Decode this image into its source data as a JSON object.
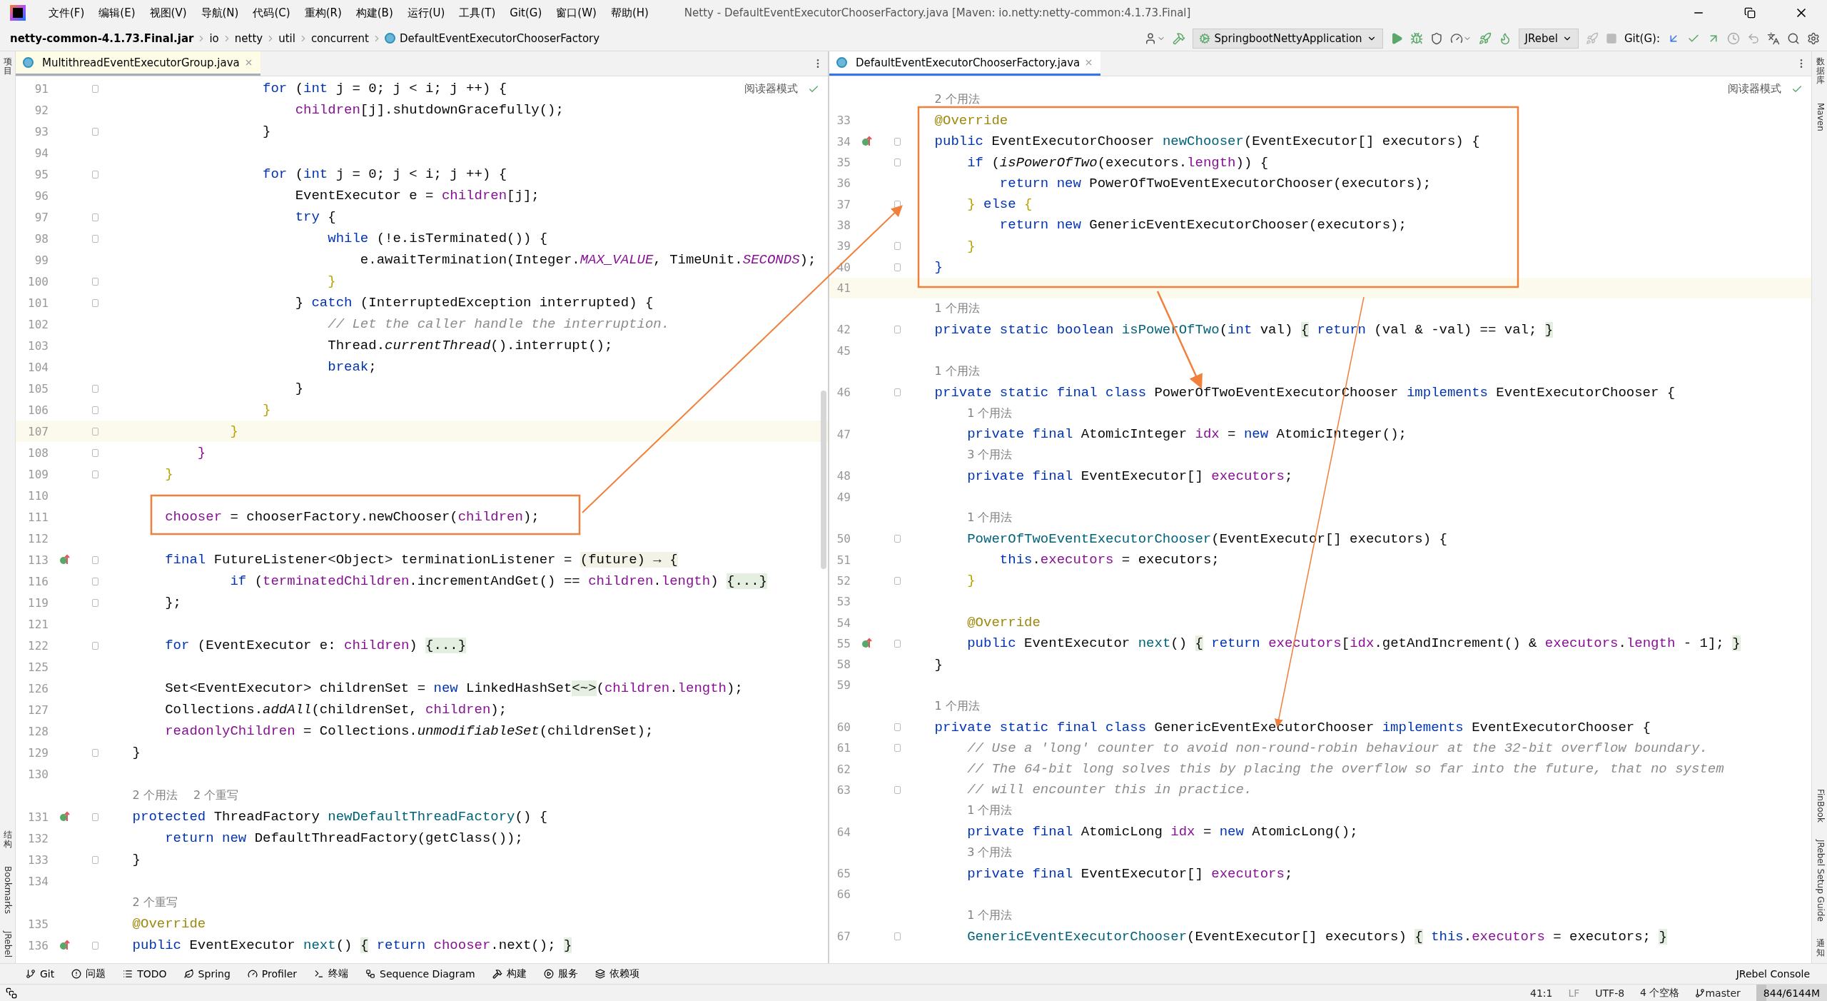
{
  "window": {
    "title": "Netty - DefaultEventExecutorChooserFactory.java [Maven: io.netty:netty-common:4.1.73.Final]"
  },
  "menu": [
    "文件(F)",
    "编辑(E)",
    "视图(V)",
    "导航(N)",
    "代码(C)",
    "重构(R)",
    "构建(B)",
    "运行(U)",
    "工具(T)",
    "Git(G)",
    "窗口(W)",
    "帮助(H)"
  ],
  "breadcrumb": [
    {
      "label": "netty-common-4.1.73.Final.jar",
      "kind": "jar"
    },
    {
      "label": "io",
      "kind": "folder"
    },
    {
      "label": "netty",
      "kind": "folder"
    },
    {
      "label": "util",
      "kind": "folder"
    },
    {
      "label": "concurrent",
      "kind": "folder"
    },
    {
      "label": "DefaultEventExecutorChooserFactory",
      "kind": "class"
    }
  ],
  "toolbar": {
    "run_config": "SpringbootNettyApplication",
    "jrebel": "JRebel",
    "git_label": "Git(G):"
  },
  "left_strip": {
    "top": [
      "项目"
    ],
    "bottom": [
      "结构",
      "Bookmarks",
      "JRebel"
    ]
  },
  "right_strip": {
    "top": [
      "数据库",
      "Maven"
    ],
    "bottom": [
      "FinBook",
      "JRebel Setup Guide",
      "通知"
    ]
  },
  "panes": [
    {
      "tab": {
        "label": "MultithreadEventExecutorGroup.java",
        "selected": false
      },
      "reader_mode": "阅读器模式",
      "lines": [
        {
          "number": "91",
          "fold": true,
          "segments": [
            {
              "text": "                    for",
              "kind": "keyword"
            },
            {
              "text": " (",
              "kind": "plain"
            },
            {
              "text": "int",
              "kind": "keyword"
            },
            {
              "text": " j = 0; j < i; j ++) {",
              "kind": "plain"
            }
          ]
        },
        {
          "number": "92",
          "segments": [
            {
              "text": "                        children",
              "kind": "field"
            },
            {
              "text": "[j].shutdownGracefully();",
              "kind": "plain"
            }
          ]
        },
        {
          "number": "93",
          "fold": true,
          "segments": [
            {
              "text": "                    }",
              "kind": "plain"
            }
          ]
        },
        {
          "number": "94"
        },
        {
          "number": "95",
          "fold": true,
          "segments": [
            {
              "text": "                    for",
              "kind": "keyword"
            },
            {
              "text": " (",
              "kind": "plain"
            },
            {
              "text": "int",
              "kind": "keyword"
            },
            {
              "text": " j = 0; j < i; j ++) {",
              "kind": "plain"
            }
          ]
        },
        {
          "number": "96",
          "segments": [
            {
              "text": "                        EventExecutor e = ",
              "kind": "plain"
            },
            {
              "text": "children",
              "kind": "field"
            },
            {
              "text": "[j];",
              "kind": "plain"
            }
          ]
        },
        {
          "number": "97",
          "fold": true,
          "segments": [
            {
              "text": "                        try",
              "kind": "keyword"
            },
            {
              "text": " {",
              "kind": "plain"
            }
          ]
        },
        {
          "number": "98",
          "fold": true,
          "segments": [
            {
              "text": "                            while",
              "kind": "keyword"
            },
            {
              "text": " (!e.isTerminated()) {",
              "kind": "plain"
            }
          ]
        },
        {
          "number": "99",
          "segments": [
            {
              "text": "                                e.awaitTermination(Integer.",
              "kind": "plain"
            },
            {
              "text": "MAX_VALUE",
              "kind": "static-field"
            },
            {
              "text": ", TimeUnit.",
              "kind": "plain"
            },
            {
              "text": "SECONDS",
              "kind": "static-field"
            },
            {
              "text": ");",
              "kind": "plain"
            }
          ]
        },
        {
          "number": "100",
          "fold": true,
          "segments": [
            {
              "text": "                            }",
              "kind": "brace"
            }
          ]
        },
        {
          "number": "101",
          "fold": true,
          "segments": [
            {
              "text": "                        } ",
              "kind": "plain"
            },
            {
              "text": "catch",
              "kind": "keyword"
            },
            {
              "text": " (InterruptedException interrupted) {",
              "kind": "plain"
            }
          ]
        },
        {
          "number": "102",
          "segments": [
            {
              "text": "                            // Let the caller handle the interruption.",
              "kind": "comment"
            }
          ]
        },
        {
          "number": "103",
          "segments": [
            {
              "text": "                            Thread.",
              "kind": "plain"
            },
            {
              "text": "currentThread",
              "kind": "static"
            },
            {
              "text": "().interrupt();",
              "kind": "plain"
            }
          ]
        },
        {
          "number": "104",
          "segments": [
            {
              "text": "                            break",
              "kind": "keyword"
            },
            {
              "text": ";",
              "kind": "plain"
            }
          ]
        },
        {
          "number": "105",
          "fold": true,
          "segments": [
            {
              "text": "                        }",
              "kind": "plain"
            }
          ]
        },
        {
          "number": "106",
          "fold": true,
          "segments": [
            {
              "text": "                    }",
              "kind": "brace"
            }
          ]
        },
        {
          "number": "107",
          "fold": true,
          "current": true,
          "segments": [
            {
              "text": "                }",
              "kind": "brace"
            }
          ]
        },
        {
          "number": "108",
          "fold": true,
          "segments": [
            {
              "text": "            }",
              "kind": "field"
            }
          ]
        },
        {
          "number": "109",
          "fold": true,
          "segments": [
            {
              "text": "        }",
              "kind": "brace"
            }
          ]
        },
        {
          "number": "110"
        },
        {
          "number": "111",
          "segments": [
            {
              "text": "        chooser",
              "kind": "field"
            },
            {
              "text": " = chooserFactory.newChooser(",
              "kind": "plain"
            },
            {
              "text": "children",
              "kind": "field"
            },
            {
              "text": ");",
              "kind": "plain"
            }
          ]
        },
        {
          "number": "112"
        },
        {
          "number": "113",
          "fold": true,
          "gutter_mark": true,
          "segments": [
            {
              "text": "        final",
              "kind": "keyword"
            },
            {
              "text": " FutureListener<Object> terminationListener = ",
              "kind": "plain"
            },
            {
              "text": "(future) → {",
              "kind": "lambda"
            }
          ]
        },
        {
          "number": "116",
          "fold": true,
          "segments": [
            {
              "text": "                if",
              "kind": "keyword"
            },
            {
              "text": " (",
              "kind": "plain"
            },
            {
              "text": "terminatedChildren",
              "kind": "field"
            },
            {
              "text": ".incrementAndGet() == ",
              "kind": "plain"
            },
            {
              "text": "children",
              "kind": "field"
            },
            {
              "text": ".",
              "kind": "plain"
            },
            {
              "text": "length",
              "kind": "field"
            },
            {
              "text": ") ",
              "kind": "plain"
            },
            {
              "text": "{...}",
              "kind": "folded"
            }
          ]
        },
        {
          "number": "119",
          "fold": true,
          "segments": [
            {
              "text": "        };",
              "kind": "plain"
            }
          ]
        },
        {
          "number": "121"
        },
        {
          "number": "122",
          "fold": true,
          "segments": [
            {
              "text": "        for",
              "kind": "keyword"
            },
            {
              "text": " (EventExecutor e: ",
              "kind": "plain"
            },
            {
              "text": "children",
              "kind": "field"
            },
            {
              "text": ") ",
              "kind": "plain"
            },
            {
              "text": "{...}",
              "kind": "folded"
            }
          ]
        },
        {
          "number": "125"
        },
        {
          "number": "126",
          "segments": [
            {
              "text": "        Set<EventExecutor> childrenSet = ",
              "kind": "plain"
            },
            {
              "text": "new",
              "kind": "keyword"
            },
            {
              "text": " LinkedHashSet",
              "kind": "plain"
            },
            {
              "text": "<~>",
              "kind": "folded"
            },
            {
              "text": "(",
              "kind": "plain"
            },
            {
              "text": "children",
              "kind": "field"
            },
            {
              "text": ".",
              "kind": "plain"
            },
            {
              "text": "length",
              "kind": "field"
            },
            {
              "text": ");",
              "kind": "plain"
            }
          ]
        },
        {
          "number": "127",
          "segments": [
            {
              "text": "        Collections.",
              "kind": "plain"
            },
            {
              "text": "addAll",
              "kind": "static"
            },
            {
              "text": "(childrenSet, ",
              "kind": "plain"
            },
            {
              "text": "children",
              "kind": "field"
            },
            {
              "text": ");",
              "kind": "plain"
            }
          ]
        },
        {
          "number": "128",
          "segments": [
            {
              "text": "        readonlyChildren",
              "kind": "field"
            },
            {
              "text": " = Collections.",
              "kind": "plain"
            },
            {
              "text": "unmodifiableSet",
              "kind": "static"
            },
            {
              "text": "(childrenSet);",
              "kind": "plain"
            }
          ]
        },
        {
          "number": "129",
          "fold": true,
          "segments": [
            {
              "text": "    }",
              "kind": "plain"
            }
          ]
        },
        {
          "number": "130"
        },
        {
          "kind": "hint",
          "hints": [
            "2 个用法",
            "2 个重写"
          ]
        },
        {
          "number": "131",
          "fold": true,
          "gutter_mark": true,
          "segments": [
            {
              "text": "    protected",
              "kind": "keyword"
            },
            {
              "text": " ThreadFactory ",
              "kind": "plain"
            },
            {
              "text": "newDefaultThreadFactory",
              "kind": "method"
            },
            {
              "text": "() {",
              "kind": "plain"
            }
          ]
        },
        {
          "number": "132",
          "segments": [
            {
              "text": "        return new",
              "kind": "keyword"
            },
            {
              "text": " DefaultThreadFactory(getClass());",
              "kind": "plain"
            }
          ]
        },
        {
          "number": "133",
          "fold": true,
          "segments": [
            {
              "text": "    }",
              "kind": "plain"
            }
          ]
        },
        {
          "number": "134"
        },
        {
          "kind": "hint",
          "hints": [
            "2 个重写"
          ]
        },
        {
          "number": "135",
          "segments": [
            {
              "text": "    @Override",
              "kind": "annotation"
            }
          ]
        },
        {
          "number": "136",
          "fold": true,
          "gutter_mark": true,
          "segments": [
            {
              "text": "    public",
              "kind": "keyword"
            },
            {
              "text": " EventExecutor ",
              "kind": "plain"
            },
            {
              "text": "next",
              "kind": "method"
            },
            {
              "text": "() ",
              "kind": "plain"
            },
            {
              "text": "{",
              "kind": "folded"
            },
            {
              "text": " return",
              "kind": "keyword"
            },
            {
              "text": " chooser",
              "kind": "field"
            },
            {
              "text": ".next(); ",
              "kind": "plain"
            },
            {
              "text": "}",
              "kind": "folded"
            }
          ]
        }
      ]
    },
    {
      "tab": {
        "label": "DefaultEventExecutorChooserFactory.java",
        "selected": true
      },
      "reader_mode": "阅读器模式",
      "lines": [
        {
          "kind": "hint",
          "hints": [
            "2 个用法"
          ]
        },
        {
          "number": "33",
          "segments": [
            {
              "text": "    @Override",
              "kind": "annotation"
            }
          ]
        },
        {
          "number": "34",
          "fold": true,
          "gutter_mark": true,
          "segments": [
            {
              "text": "    public",
              "kind": "keyword"
            },
            {
              "text": " EventExecutorChooser ",
              "kind": "plain"
            },
            {
              "text": "newChooser",
              "kind": "method"
            },
            {
              "text": "(EventExecutor[] executors) {",
              "kind": "plain"
            }
          ]
        },
        {
          "number": "35",
          "fold": true,
          "segments": [
            {
              "text": "        if",
              "kind": "keyword"
            },
            {
              "text": " (",
              "kind": "plain"
            },
            {
              "text": "isPowerOfTwo",
              "kind": "static"
            },
            {
              "text": "(executors.",
              "kind": "plain"
            },
            {
              "text": "length",
              "kind": "field"
            },
            {
              "text": ")) {",
              "kind": "plain"
            }
          ]
        },
        {
          "number": "36",
          "segments": [
            {
              "text": "            return new",
              "kind": "keyword"
            },
            {
              "text": " PowerOfTwoEventExecutorChooser(executors);",
              "kind": "plain"
            }
          ]
        },
        {
          "number": "37",
          "fold": true,
          "segments": [
            {
              "text": "        } ",
              "kind": "brace"
            },
            {
              "text": "else",
              "kind": "keyword"
            },
            {
              "text": " {",
              "kind": "brace"
            }
          ]
        },
        {
          "number": "38",
          "segments": [
            {
              "text": "            return new",
              "kind": "keyword"
            },
            {
              "text": " GenericEventExecutorChooser(executors);",
              "kind": "plain"
            }
          ]
        },
        {
          "number": "39",
          "fold": true,
          "segments": [
            {
              "text": "        }",
              "kind": "brace"
            }
          ]
        },
        {
          "number": "40",
          "fold": true,
          "segments": [
            {
              "text": "    }",
              "kind": "keyword"
            }
          ]
        },
        {
          "number": "41",
          "current": true
        },
        {
          "kind": "hint",
          "hints": [
            "1 个用法"
          ]
        },
        {
          "number": "42",
          "fold": true,
          "segments": [
            {
              "text": "    private static boolean",
              "kind": "keyword"
            },
            {
              "text": " isPowerOfTwo",
              "kind": "method"
            },
            {
              "text": "(",
              "kind": "plain"
            },
            {
              "text": "int",
              "kind": "keyword"
            },
            {
              "text": " val) ",
              "kind": "plain"
            },
            {
              "text": "{",
              "kind": "folded"
            },
            {
              "text": " return",
              "kind": "keyword"
            },
            {
              "text": " (val & -val) == val; ",
              "kind": "plain"
            },
            {
              "text": "}",
              "kind": "folded"
            }
          ]
        },
        {
          "number": "45"
        },
        {
          "kind": "hint",
          "hints": [
            "1 个用法"
          ]
        },
        {
          "number": "46",
          "fold": true,
          "segments": [
            {
              "text": "    private static final class",
              "kind": "keyword"
            },
            {
              "text": " PowerOfTwoEventExecutorChooser ",
              "kind": "plain"
            },
            {
              "text": "implements",
              "kind": "keyword"
            },
            {
              "text": " EventExecutorChooser {",
              "kind": "plain"
            }
          ]
        },
        {
          "kind": "hint",
          "hints": [
            "1 个用法"
          ]
        },
        {
          "number": "47",
          "segments": [
            {
              "text": "        private final",
              "kind": "keyword"
            },
            {
              "text": " AtomicInteger ",
              "kind": "plain"
            },
            {
              "text": "idx",
              "kind": "field"
            },
            {
              "text": " = ",
              "kind": "plain"
            },
            {
              "text": "new",
              "kind": "keyword"
            },
            {
              "text": " AtomicInteger();",
              "kind": "plain"
            }
          ]
        },
        {
          "kind": "hint",
          "hints": [
            "3 个用法"
          ]
        },
        {
          "number": "48",
          "segments": [
            {
              "text": "        private final",
              "kind": "keyword"
            },
            {
              "text": " EventExecutor[] ",
              "kind": "plain"
            },
            {
              "text": "executors",
              "kind": "field"
            },
            {
              "text": ";",
              "kind": "plain"
            }
          ]
        },
        {
          "number": "49"
        },
        {
          "kind": "hint",
          "hints": [
            "1 个用法"
          ]
        },
        {
          "number": "50",
          "fold": true,
          "segments": [
            {
              "text": "        PowerOfTwoEventExecutorChooser",
              "kind": "method"
            },
            {
              "text": "(EventExecutor[] executors) {",
              "kind": "plain"
            }
          ]
        },
        {
          "number": "51",
          "segments": [
            {
              "text": "            this",
              "kind": "keyword"
            },
            {
              "text": ".",
              "kind": "plain"
            },
            {
              "text": "executors",
              "kind": "field"
            },
            {
              "text": " = executors;",
              "kind": "plain"
            }
          ]
        },
        {
          "number": "52",
          "fold": true,
          "segments": [
            {
              "text": "        }",
              "kind": "brace"
            }
          ]
        },
        {
          "number": "53"
        },
        {
          "number": "54",
          "segments": [
            {
              "text": "        @Override",
              "kind": "annotation"
            }
          ]
        },
        {
          "number": "55",
          "fold": true,
          "gutter_mark": true,
          "segments": [
            {
              "text": "        public",
              "kind": "keyword"
            },
            {
              "text": " EventExecutor ",
              "kind": "plain"
            },
            {
              "text": "next",
              "kind": "method"
            },
            {
              "text": "() ",
              "kind": "plain"
            },
            {
              "text": "{",
              "kind": "folded"
            },
            {
              "text": " return",
              "kind": "keyword"
            },
            {
              "text": " executors",
              "kind": "field"
            },
            {
              "text": "[",
              "kind": "plain"
            },
            {
              "text": "idx",
              "kind": "field"
            },
            {
              "text": ".getAndIncrement() & ",
              "kind": "plain"
            },
            {
              "text": "executors",
              "kind": "field"
            },
            {
              "text": ".",
              "kind": "plain"
            },
            {
              "text": "length",
              "kind": "field"
            },
            {
              "text": " - 1]; ",
              "kind": "plain"
            },
            {
              "text": "}",
              "kind": "folded"
            }
          ]
        },
        {
          "number": "58",
          "segments": [
            {
              "text": "    }",
              "kind": "plain"
            }
          ]
        },
        {
          "number": "59"
        },
        {
          "kind": "hint",
          "hints": [
            "1 个用法"
          ]
        },
        {
          "number": "60",
          "fold": true,
          "segments": [
            {
              "text": "    private static final class",
              "kind": "keyword"
            },
            {
              "text": " GenericEventExecutorChooser ",
              "kind": "plain"
            },
            {
              "text": "implements",
              "kind": "keyword"
            },
            {
              "text": " EventExecutorChooser {",
              "kind": "plain"
            }
          ]
        },
        {
          "number": "61",
          "fold": true,
          "segments": [
            {
              "text": "        // Use a 'long' counter to avoid non-round-robin behaviour at the 32-bit overflow boundary.",
              "kind": "comment"
            }
          ]
        },
        {
          "number": "62",
          "segments": [
            {
              "text": "        // The 64-bit long solves this by placing the overflow so far into the future, that no system",
              "kind": "comment"
            }
          ]
        },
        {
          "number": "63",
          "fold": true,
          "segments": [
            {
              "text": "        // will encounter this in practice.",
              "kind": "comment"
            }
          ]
        },
        {
          "kind": "hint",
          "hints": [
            "1 个用法"
          ]
        },
        {
          "number": "64",
          "segments": [
            {
              "text": "        private final",
              "kind": "keyword"
            },
            {
              "text": " AtomicLong ",
              "kind": "plain"
            },
            {
              "text": "idx",
              "kind": "field"
            },
            {
              "text": " = ",
              "kind": "plain"
            },
            {
              "text": "new",
              "kind": "keyword"
            },
            {
              "text": " AtomicLong();",
              "kind": "plain"
            }
          ]
        },
        {
          "kind": "hint",
          "hints": [
            "3 个用法"
          ]
        },
        {
          "number": "65",
          "segments": [
            {
              "text": "        private final",
              "kind": "keyword"
            },
            {
              "text": " EventExecutor[] ",
              "kind": "plain"
            },
            {
              "text": "executors",
              "kind": "field"
            },
            {
              "text": ";",
              "kind": "plain"
            }
          ]
        },
        {
          "number": "66"
        },
        {
          "kind": "hint",
          "hints": [
            "1 个用法"
          ]
        },
        {
          "number": "67",
          "fold": true,
          "segments": [
            {
              "text": "        GenericEventExecutorChooser",
              "kind": "method"
            },
            {
              "text": "(EventExecutor[] executors) ",
              "kind": "plain"
            },
            {
              "text": "{",
              "kind": "folded"
            },
            {
              "text": " this",
              "kind": "keyword"
            },
            {
              "text": ".",
              "kind": "plain"
            },
            {
              "text": "executors",
              "kind": "field"
            },
            {
              "text": " = executors; ",
              "kind": "plain"
            },
            {
              "text": "}",
              "kind": "folded"
            }
          ]
        }
      ]
    }
  ],
  "tool_windows": [
    {
      "label": "Git",
      "kind": "git"
    },
    {
      "label": "问题",
      "kind": "problems"
    },
    {
      "label": "TODO",
      "kind": "todo"
    },
    {
      "label": "Spring",
      "kind": "spring"
    },
    {
      "label": "Profiler",
      "kind": "profiler"
    },
    {
      "label": "终端",
      "kind": "terminal"
    },
    {
      "label": "Sequence Diagram",
      "kind": "sequence"
    },
    {
      "label": "构建",
      "kind": "build"
    },
    {
      "label": "服务",
      "kind": "services"
    },
    {
      "label": "依赖项",
      "kind": "deps"
    }
  ],
  "jrebel_console": "JRebel Console",
  "status": {
    "position": "41:1",
    "line_ending": "LF",
    "encoding": "UTF-8",
    "indent": "4 个空格",
    "branch": "master",
    "memory": {
      "text": "844/6144M",
      "level": 0.14
    }
  }
}
